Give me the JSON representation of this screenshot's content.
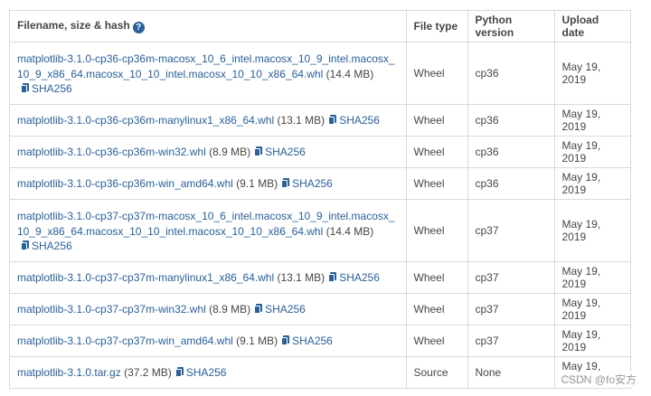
{
  "header": {
    "filename": "Filename, size & hash",
    "help_icon": "question-circle-icon",
    "filetype": "File type",
    "pyversion": "Python version",
    "upload": "Upload date"
  },
  "rows": [
    {
      "name": "matplotlib-3.1.0-cp36-cp36m-macosx_10_6_intel.macosx_10_9_intel.macosx_10_9_x86_64.macosx_10_10_intel.macosx_10_10_x86_64.whl",
      "size": "(14.4 MB)",
      "hash": "SHA256",
      "type": "Wheel",
      "py": "cp36",
      "date": "May 19, 2019"
    },
    {
      "name": "matplotlib-3.1.0-cp36-cp36m-manylinux1_x86_64.whl",
      "size": "(13.1 MB)",
      "hash": "SHA256",
      "type": "Wheel",
      "py": "cp36",
      "date": "May 19, 2019"
    },
    {
      "name": "matplotlib-3.1.0-cp36-cp36m-win32.whl",
      "size": "(8.9 MB)",
      "hash": "SHA256",
      "type": "Wheel",
      "py": "cp36",
      "date": "May 19, 2019"
    },
    {
      "name": "matplotlib-3.1.0-cp36-cp36m-win_amd64.whl",
      "size": "(9.1 MB)",
      "hash": "SHA256",
      "type": "Wheel",
      "py": "cp36",
      "date": "May 19, 2019"
    },
    {
      "name": "matplotlib-3.1.0-cp37-cp37m-macosx_10_6_intel.macosx_10_9_intel.macosx_10_9_x86_64.macosx_10_10_intel.macosx_10_10_x86_64.whl",
      "size": "(14.4 MB)",
      "hash": "SHA256",
      "type": "Wheel",
      "py": "cp37",
      "date": "May 19, 2019"
    },
    {
      "name": "matplotlib-3.1.0-cp37-cp37m-manylinux1_x86_64.whl",
      "size": "(13.1 MB)",
      "hash": "SHA256",
      "type": "Wheel",
      "py": "cp37",
      "date": "May 19, 2019"
    },
    {
      "name": "matplotlib-3.1.0-cp37-cp37m-win32.whl",
      "size": "(8.9 MB)",
      "hash": "SHA256",
      "type": "Wheel",
      "py": "cp37",
      "date": "May 19, 2019"
    },
    {
      "name": "matplotlib-3.1.0-cp37-cp37m-win_amd64.whl",
      "size": "(9.1 MB)",
      "hash": "SHA256",
      "type": "Wheel",
      "py": "cp37",
      "date": "May 19, 2019"
    },
    {
      "name": "matplotlib-3.1.0.tar.gz",
      "size": "(37.2 MB)",
      "hash": "SHA256",
      "type": "Source",
      "py": "None",
      "date": "May 19, 2019"
    }
  ],
  "copy_icon": "copy-icon",
  "watermark": "CSDN @fo安方"
}
